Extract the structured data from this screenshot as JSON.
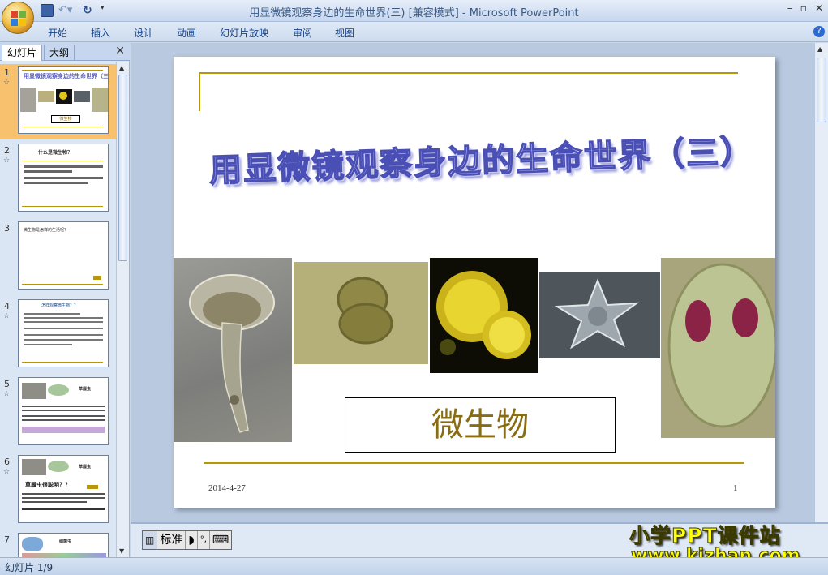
{
  "window": {
    "title_doc": "用显微镜观察身边的生命世界(三) [兼容模式]",
    "title_sep": " - ",
    "title_app": "Microsoft PowerPoint",
    "minimize": "–",
    "restore": "▫",
    "close": "✕"
  },
  "ribbon": {
    "tabs": [
      "开始",
      "插入",
      "设计",
      "动画",
      "幻灯片放映",
      "审阅",
      "视图"
    ],
    "help": "?"
  },
  "left_panel": {
    "tab_slides": "幻灯片",
    "tab_outline": "大纲",
    "close": "✕",
    "thumbnails": [
      {
        "num": "1",
        "star": "☆",
        "texts": [
          "用显微镜观察身边的生命世界（三）",
          "微生物"
        ]
      },
      {
        "num": "2",
        "star": "☆",
        "texts": [
          "什么是微生物？"
        ]
      },
      {
        "num": "3",
        "star": "",
        "texts": [
          "微生物是怎样的生活呢？"
        ]
      },
      {
        "num": "4",
        "star": "☆",
        "texts": [
          "怎样观察微生物？？"
        ]
      },
      {
        "num": "5",
        "star": "☆",
        "texts": [
          "草履虫"
        ]
      },
      {
        "num": "6",
        "star": "☆",
        "texts": [
          "草履虫很聪明？？",
          "草履虫"
        ]
      },
      {
        "num": "7",
        "star": "",
        "texts": [
          "细菌虫"
        ]
      }
    ]
  },
  "slide": {
    "title": "用显微镜观察身边的生命世界（三）",
    "subtitle": "微生物",
    "date": "2014-4-27",
    "page": "1"
  },
  "ime": {
    "mode": "标准"
  },
  "watermark": {
    "line1": "小学PPT课件站",
    "line2": "www.kjzhan.com"
  },
  "status": {
    "slide_counter": "幻灯片 1/9"
  },
  "colors": {
    "accent_gold": "#b8960a",
    "selected_thumb": "#f8c16e",
    "title_stroke": "#4a4fb5"
  }
}
